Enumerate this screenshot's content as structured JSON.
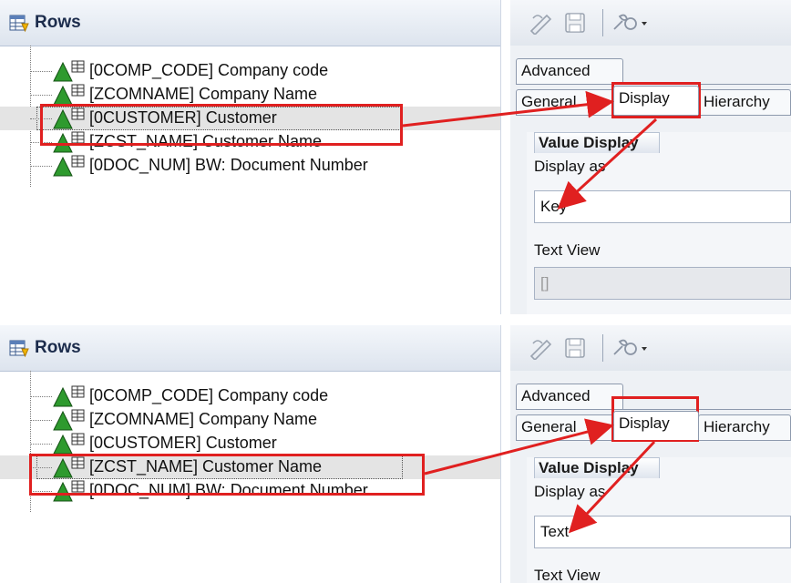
{
  "panels": [
    {
      "rows_title": "Rows",
      "tree_items": [
        {
          "label": "[0COMP_CODE] Company code"
        },
        {
          "label": "[ZCOMNAME] Company Name"
        },
        {
          "label": "[0CUSTOMER] Customer"
        },
        {
          "label": "[ZCST_NAME] Customer Name"
        },
        {
          "label": "[0DOC_NUM] BW: Document Number"
        }
      ],
      "selected_index": 2,
      "tabs": {
        "advanced": "Advanced",
        "general": "General",
        "display": "Display",
        "hierarchy": "Hierarchy"
      },
      "group_title": "Value Display",
      "display_as_label": "Display as",
      "display_as_value": "Key",
      "text_view_label": "Text View",
      "text_view_value": "[]"
    },
    {
      "rows_title": "Rows",
      "tree_items": [
        {
          "label": "[0COMP_CODE] Company code"
        },
        {
          "label": "[ZCOMNAME] Company Name"
        },
        {
          "label": "[0CUSTOMER] Customer"
        },
        {
          "label": "[ZCST_NAME] Customer Name"
        },
        {
          "label": "[0DOC_NUM] BW: Document Number"
        }
      ],
      "selected_index": 3,
      "tabs": {
        "advanced": "Advanced",
        "general": "General",
        "display": "Display",
        "hierarchy": "Hierarchy"
      },
      "group_title": "Value Display",
      "display_as_label": "Display as",
      "display_as_value": "Text",
      "text_view_label": "Text View"
    }
  ],
  "icons": {
    "rows": "rows-icon",
    "tree_item": "characteristic-icon",
    "toolbar": [
      "edit-icon",
      "save-icon",
      "tools-dropdown-icon"
    ]
  },
  "colors": {
    "highlight_red": "#e02020",
    "selected_row": "#e4e4e4",
    "icon_green": "#2e9a2e"
  }
}
